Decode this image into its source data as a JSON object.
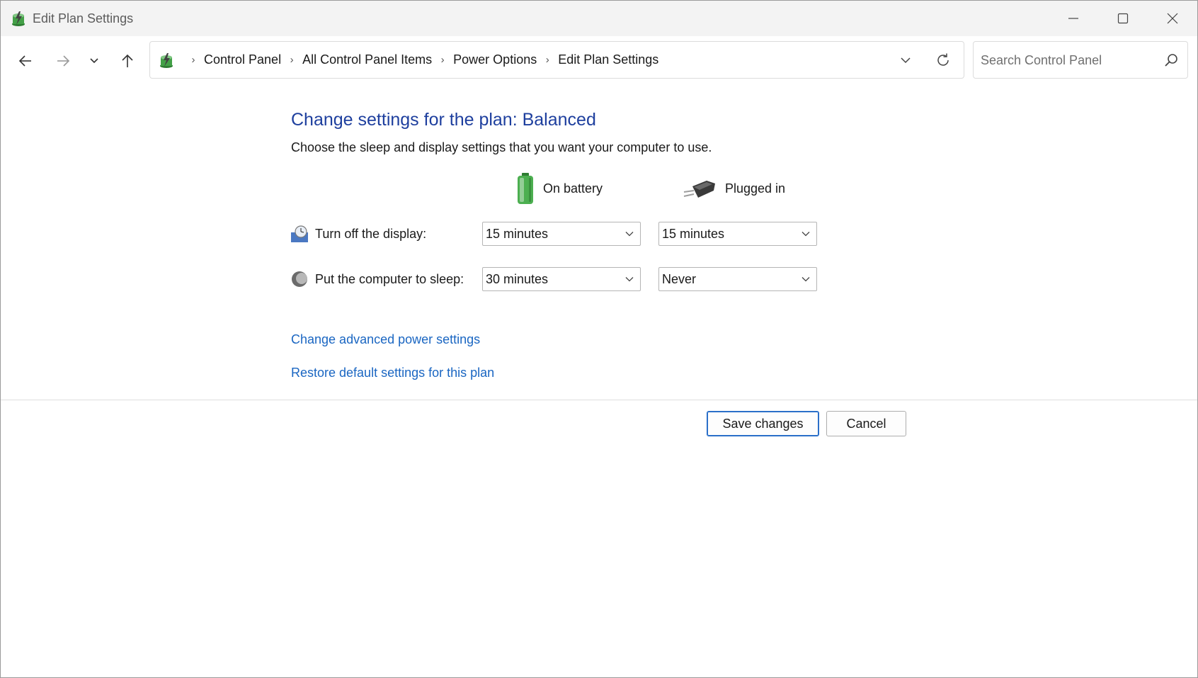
{
  "window": {
    "title": "Edit Plan Settings",
    "icons": {
      "app": "power-options-icon"
    }
  },
  "nav": {
    "back_icon": "arrow-left-icon",
    "forward_icon": "arrow-right-icon",
    "recent_icon": "chevron-down-icon",
    "up_icon": "arrow-up-icon"
  },
  "address": {
    "crumbs": [
      "Control Panel",
      "All Control Panel Items",
      "Power Options",
      "Edit Plan Settings"
    ],
    "separator": "›"
  },
  "search": {
    "placeholder": "Search Control Panel",
    "value": ""
  },
  "main": {
    "heading": "Change settings for the plan: Balanced",
    "subheading": "Choose the sleep and display settings that you want your computer to use.",
    "columns": {
      "battery": "On battery",
      "plugged": "Plugged in"
    },
    "rows": {
      "display": {
        "label": "Turn off the display:",
        "battery_value": "15 minutes",
        "plugged_value": "15 minutes"
      },
      "sleep": {
        "label": "Put the computer to sleep:",
        "battery_value": "30 minutes",
        "plugged_value": "Never"
      }
    },
    "links": {
      "advanced": "Change advanced power settings",
      "restore": "Restore default settings for this plan"
    }
  },
  "footer": {
    "save_label": "Save changes",
    "cancel_label": "Cancel"
  },
  "colors": {
    "heading": "#1e3f9e",
    "link": "#1a66c2",
    "primary_button_border": "#2a6fc9",
    "titlebar_bg": "#f3f3f3"
  }
}
